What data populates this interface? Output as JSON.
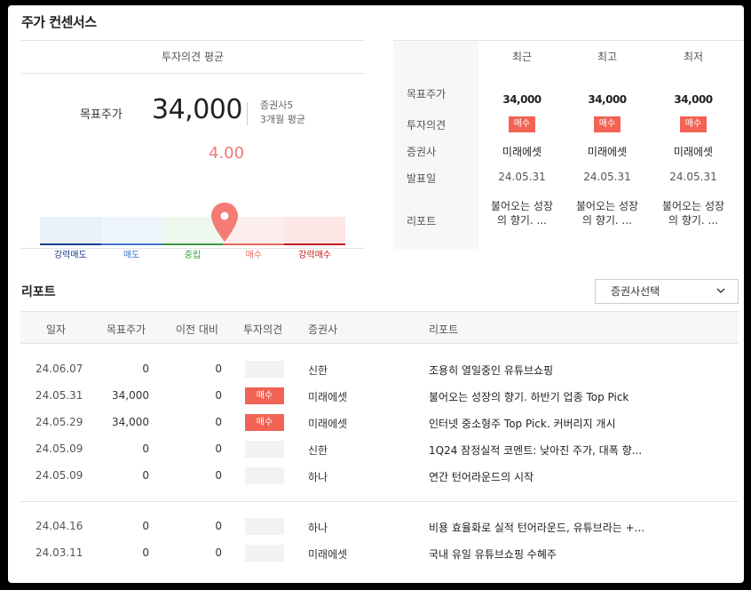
{
  "section_title": "주가 컨센서스",
  "consensus": {
    "avg_header": "투자의견 평균",
    "target_label": "목표주가",
    "target_value": "34,000",
    "brokers_count": "증권사5",
    "period": "3개월 평균",
    "score": "4.00",
    "score_value": 4.0,
    "scale": [
      {
        "label": "강력매도",
        "fill": "#e8f0fa",
        "line": "#1d3f8a",
        "text": "#1d3f8a"
      },
      {
        "label": "매도",
        "fill": "#eef5fd",
        "line": "#3f74c9",
        "text": "#3f74c9"
      },
      {
        "label": "중립",
        "fill": "#eef8ef",
        "line": "#3a9a3c",
        "text": "#3a9a3c"
      },
      {
        "label": "매수",
        "fill": "#fdeeee",
        "line": "#e66b5e",
        "text": "#e66b5e"
      },
      {
        "label": "강력매수",
        "fill": "#fde6e6",
        "line": "#c41a1a",
        "text": "#c41a1a"
      }
    ],
    "pin_color": "#f47c74"
  },
  "summary": {
    "headers": [
      "최근",
      "최고",
      "최저"
    ],
    "row_labels": [
      "목표주가",
      "투자의견",
      "증권사",
      "발표일",
      "리포트"
    ],
    "columns": [
      {
        "target": "34,000",
        "opinion": "매수",
        "broker": "미래에셋",
        "date": "24.05.31",
        "report_line1": "불어오는 성장",
        "report_line2": "의 향기. ..."
      },
      {
        "target": "34,000",
        "opinion": "매수",
        "broker": "미래에셋",
        "date": "24.05.31",
        "report_line1": "불어오는 성장",
        "report_line2": "의 향기. ..."
      },
      {
        "target": "34,000",
        "opinion": "매수",
        "broker": "미래에셋",
        "date": "24.05.31",
        "report_line1": "불어오는 성장",
        "report_line2": "의 향기. ..."
      }
    ]
  },
  "reports": {
    "title": "리포트",
    "broker_select": "증권사선택",
    "headers": [
      "일자",
      "목표주가",
      "이전 대비",
      "투자의견",
      "증권사",
      "리포트"
    ],
    "rows": [
      {
        "date": "24.06.07",
        "target": "0",
        "change": "0",
        "opinion": "",
        "broker": "신한",
        "report": "조용히 열일중인 유튜브쇼핑"
      },
      {
        "date": "24.05.31",
        "target": "34,000",
        "change": "0",
        "opinion": "매수",
        "broker": "미래에셋",
        "report": "불어오는 성장의 향기. 하반기 업종 Top Pick"
      },
      {
        "date": "24.05.29",
        "target": "34,000",
        "change": "0",
        "opinion": "매수",
        "broker": "미래에셋",
        "report": "인터넷 중소형주 Top Pick. 커버리지 개시"
      },
      {
        "date": "24.05.09",
        "target": "0",
        "change": "0",
        "opinion": "",
        "broker": "신한",
        "report": "1Q24 잠정실적 코멘트: 낮아진 주가, 대폭 향..."
      },
      {
        "date": "24.05.09",
        "target": "0",
        "change": "0",
        "opinion": "",
        "broker": "하나",
        "report": "연간 턴어라운드의 시작"
      },
      {
        "date": "24.04.16",
        "target": "0",
        "change": "0",
        "opinion": "",
        "broker": "하나",
        "report": "비용 효율화로 실적 턴어라운드, 유튜브라는 +..."
      },
      {
        "date": "24.03.11",
        "target": "0",
        "change": "0",
        "opinion": "",
        "broker": "미래에셋",
        "report": "국내 유일 유튜브쇼핑 수혜주"
      }
    ]
  }
}
